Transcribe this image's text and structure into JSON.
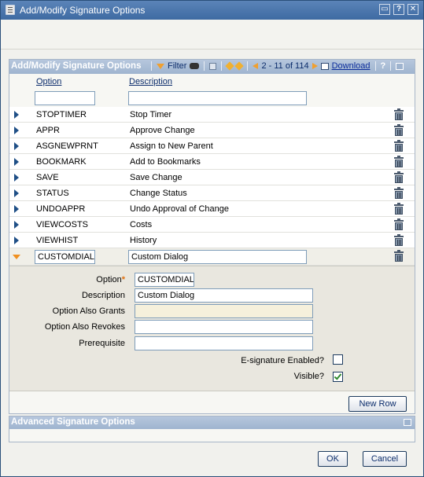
{
  "window": {
    "title": "Add/Modify Signature Options"
  },
  "panel": {
    "title": "Add/Modify Signature Options",
    "filter_label": "Filter",
    "range_text": "2 - 11 of 114",
    "download_label": "Download",
    "help_label": "?"
  },
  "columns": {
    "option": "Option",
    "description": "Description"
  },
  "rows": [
    {
      "option": "STOPTIMER",
      "description": "Stop Timer"
    },
    {
      "option": "APPR",
      "description": "Approve Change"
    },
    {
      "option": "ASGNEWPRNT",
      "description": "Assign to New Parent"
    },
    {
      "option": "BOOKMARK",
      "description": "Add to Bookmarks"
    },
    {
      "option": "SAVE",
      "description": "Save Change"
    },
    {
      "option": "STATUS",
      "description": "Change Status"
    },
    {
      "option": "UNDOAPPR",
      "description": "Undo Approval of Change"
    },
    {
      "option": "VIEWCOSTS",
      "description": "Costs"
    },
    {
      "option": "VIEWHIST",
      "description": "History"
    }
  ],
  "selected_row": {
    "option": "CUSTOMDIALO",
    "description": "Custom Dialog"
  },
  "detail": {
    "option_label": "Option",
    "required_marker": "*",
    "option_value": "CUSTOMDIALO",
    "description_label": "Description",
    "description_value": "Custom Dialog",
    "grants_label": "Option Also Grants",
    "grants_value": "",
    "revokes_label": "Option Also Revokes",
    "revokes_value": "",
    "prerequisite_label": "Prerequisite",
    "prerequisite_value": "",
    "esig_label": "E-signature Enabled?",
    "esig_checked": false,
    "visible_label": "Visible?",
    "visible_checked": true
  },
  "buttons": {
    "new_row": "New Row",
    "ok": "OK",
    "cancel": "Cancel"
  },
  "advanced": {
    "title": "Advanced Signature Options"
  }
}
